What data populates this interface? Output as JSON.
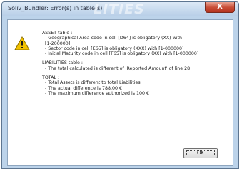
{
  "window": {
    "title": "Soliv_Bundler: Error(s) in table(s)",
    "watermark": "LITIES",
    "close_label": "X"
  },
  "message": {
    "asset_heading": "ASSET table :",
    "asset_line1": "- Geographical Area code in cell [D64] is obligatory (XX) with",
    "asset_line1b": "[1-200000]",
    "asset_line2": "- Sector code in cell [E65] is obligatory (XXX) with [1-000000]",
    "asset_line3": "- Initial Maturity code in cell [F65] is obligatory (XX) with [1-000000]",
    "liab_heading": "LIABILITIES table :",
    "liab_line1": "- The total calculated is different of 'Reported Amount' of line 28",
    "total_heading": "TOTAL :",
    "total_line1": "- Total Assets is different to total Liabilities",
    "total_line2": "- The actual difference is 788.00 €",
    "total_line3": "- The maximum difference authorized is 100 €"
  },
  "buttons": {
    "ok_label": "OK"
  },
  "icons": {
    "warning": "warning-icon",
    "warning_color": "#f2c200"
  }
}
